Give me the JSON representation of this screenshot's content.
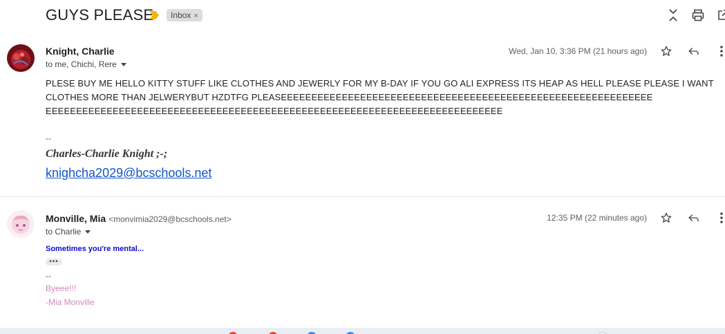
{
  "thread": {
    "subject": "GUYS PLEASE",
    "label": "Inbox",
    "label_close": "×"
  },
  "colors": {
    "importance_marker": "#f4b400",
    "link": "#1155cc",
    "blue_text": "#0b0bd0",
    "pink_text": "#cc88bb"
  },
  "toolbar_icons": [
    "collapse-icon",
    "print-icon",
    "open-in-new-window-icon"
  ],
  "messages": [
    {
      "sender": "Knight, Charlie",
      "sender_email": "",
      "recipients": "to me, Chichi, Rere",
      "timestamp": "Wed, Jan 10, 3:36 PM (21 hours ago)",
      "body_lines": [
        "PLESE BUY ME HELLO KITTY STUFF LIKE CLOTHES AND JEWERLY FOR MY B-DAY IF YOU GO ALI EXPRESS ITS HEAP AS HELL PLEASE PLEASE I WANT",
        "CLOTHES MORE THAN JELWERYBUT HZDTFG PLEASEEEEEEEEEEEEEEEEEEEEEEEEEEEEEEEEEEEEEEEEEEEEEEEEEEEEEEEEEEEEE",
        "EEEEEEEEEEEEEEEEEEEEEEEEEEEEEEEEEEEEEEEEEEEEEEEEEEEEEEEEEEEEEEEEEEEEEEEEEEE"
      ],
      "signature_sep": "--",
      "signature_name": "Charles-Charlie Knight ;-;",
      "signature_link": "knighcha2029@bcschools.net"
    },
    {
      "sender": "Monville, Mia",
      "sender_email": "<monvimia2029@bcschools.net>",
      "recipients": "to Charlie",
      "timestamp": "12:35 PM (22 minutes ago)",
      "body_bold": "Sometimes you're mental...",
      "trimmed": "•••",
      "signature_sep": "--",
      "signature_line1": "Byeee!!!",
      "signature_line2": "-Mia Monville"
    }
  ]
}
